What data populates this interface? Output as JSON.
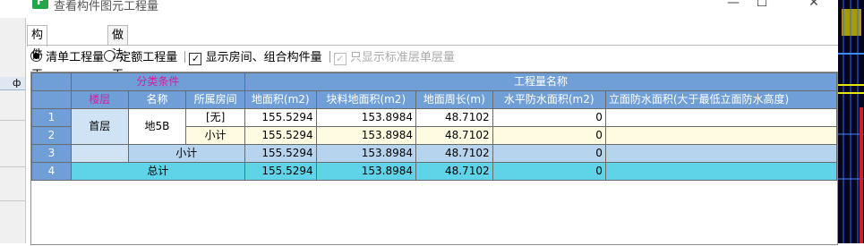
{
  "window": {
    "title": "查看构件图元工程量",
    "icon_letter": "F",
    "minimize": "—",
    "maximize": "☐",
    "close": "✕"
  },
  "tabs": [
    {
      "label": "构件工程量",
      "active": true
    },
    {
      "label": "做法工程量",
      "active": false
    }
  ],
  "options": {
    "radio_list": "清单工程量",
    "radio_quota": "定额工程量",
    "check_room": "显示房间、组合构件量",
    "check_std": "只显示标准层单层量",
    "check_mark": "✓"
  },
  "left_panel": {
    "pin_icon": "ф"
  },
  "table": {
    "group_left": "分类条件",
    "group_right": "工程量名称",
    "headers": [
      "楼层",
      "名称",
      "所属房间",
      "地面积(m2)",
      "块料地面积(m2)",
      "地面周长(m)",
      "水平防水面积(m2)",
      "立面防水面积(大于最低立面防水高度)"
    ],
    "rows": [
      {
        "num": "1",
        "floor": "首层",
        "name": "地5B",
        "room": "[无]",
        "v1": "155.5294",
        "v2": "153.8984",
        "v3": "48.7102",
        "v4": "0"
      },
      {
        "num": "2",
        "room": "小计",
        "v1": "155.5294",
        "v2": "153.8984",
        "v3": "48.7102",
        "v4": "0"
      },
      {
        "num": "3",
        "label": "小计",
        "v1": "155.5294",
        "v2": "153.8984",
        "v3": "48.7102",
        "v4": "0"
      },
      {
        "num": "4",
        "label": "总计",
        "v1": "155.5294",
        "v2": "153.8984",
        "v3": "48.7102",
        "v4": "0"
      }
    ]
  }
}
